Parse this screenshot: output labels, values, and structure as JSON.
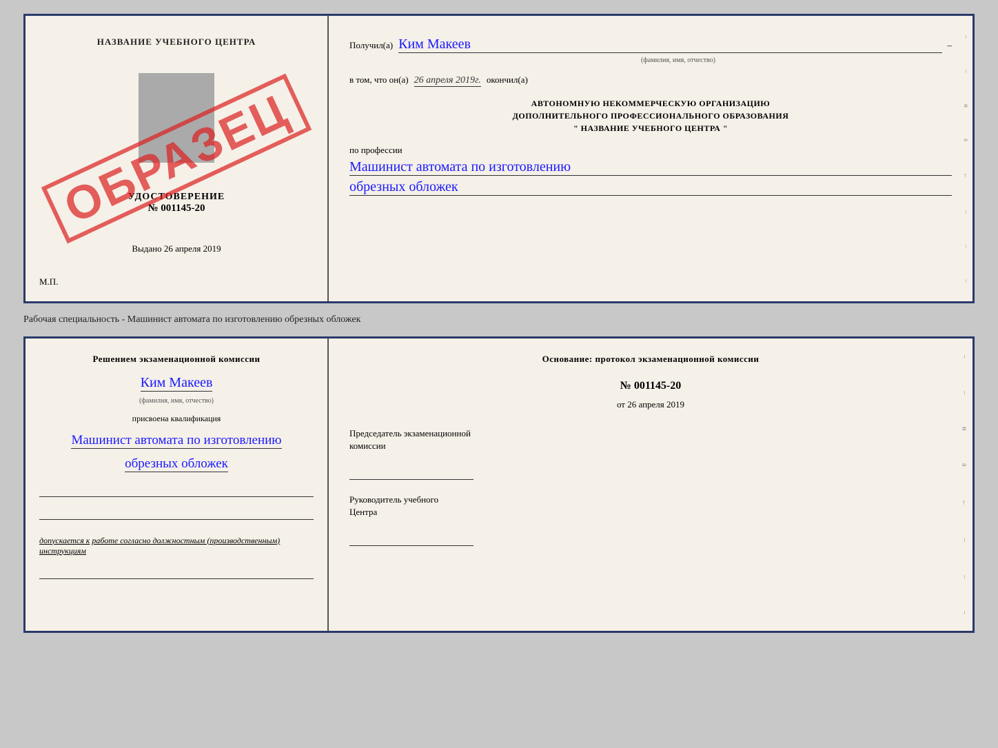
{
  "top_document": {
    "left": {
      "center_title": "НАЗВАНИЕ УЧЕБНОГО ЦЕНТРА",
      "udostoverenie_label": "УДОСТОВЕРЕНИЕ",
      "number": "№ 001145-20",
      "vydano_label": "Выдано",
      "vydano_date": "26 апреля 2019",
      "mp_label": "М.П.",
      "stamp_text": "ОБРАЗЕЦ"
    },
    "right": {
      "recipient_label": "Получил(а)",
      "recipient_name": "Ким Макеев",
      "recipient_dash": "–",
      "fio_sub": "(фамилия, имя, отчество)",
      "vtom_label": "в том, что он(а)",
      "vtom_date": "26 апреля 2019г.",
      "okoncil_label": "окончил(а)",
      "org_line1": "АВТОНОМНУЮ НЕКОММЕРЧЕСКУЮ ОРГАНИЗАЦИЮ",
      "org_line2": "ДОПОЛНИТЕЛЬНОГО ПРОФЕССИОНАЛЬНОГО ОБРАЗОВАНИЯ",
      "org_name_prefix": "\"",
      "org_name": "НАЗВАНИЕ УЧЕБНОГО ЦЕНТРА",
      "org_name_suffix": "\"",
      "po_professii": "по профессии",
      "profession_line1": "Машинист автомата по изготовлению",
      "profession_line2": "обрезных обложек"
    }
  },
  "separator": {
    "text": "Рабочая специальность - Машинист автомата по изготовлению обрезных обложек"
  },
  "bottom_document": {
    "left": {
      "resheniem_line1": "Решением экзаменационной комиссии",
      "komissia_name": "Ким Макеев",
      "fio_sub": "(фамилия, имя, отчество)",
      "prisvoena": "присвоена квалификация",
      "kvalif_line1": "Машинист автомата по изготовлению",
      "kvalif_line2": "обрезных обложек",
      "dopuskaetsya_label": "допускается к",
      "dopuskaetsya_text": "работе согласно должностным (производственным) инструкциям"
    },
    "right": {
      "osnovanie_label": "Основание: протокол экзаменационной комиссии",
      "protocol_num": "№  001145-20",
      "ot_label": "от",
      "ot_date": "26 апреля 2019",
      "predsedatel_label": "Председатель экзаменационной",
      "predsedatel_label2": "комиссии",
      "rukovoditel_label": "Руководитель учебного",
      "rukovoditel_label2": "Центра"
    }
  }
}
